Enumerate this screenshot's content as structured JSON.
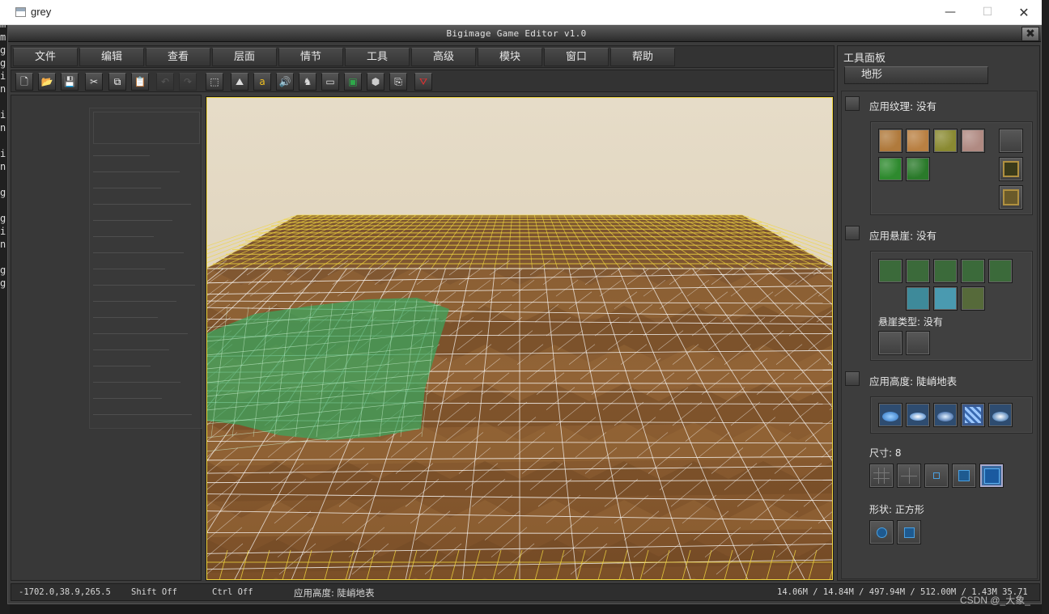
{
  "os_window": {
    "title": "grey",
    "minimize_glyph": "—",
    "maximize_glyph": "☐",
    "close_glyph": "✕"
  },
  "background_console": {
    "left_chars": [
      "i",
      "m",
      "m",
      "g",
      "g",
      "i",
      "n",
      "",
      "i",
      "n",
      "",
      "i",
      "n",
      "",
      "g",
      "",
      "g",
      "i",
      "n",
      "",
      "g",
      "g"
    ]
  },
  "app": {
    "caption": "Bigimage Game Editor v1.0",
    "caption_close_glyph": "✖"
  },
  "menu": {
    "items": [
      "文件",
      "编辑",
      "查看",
      "层面",
      "情节",
      "工具",
      "高级",
      "模块",
      "窗口",
      "帮助"
    ]
  },
  "toolbar": {
    "buttons": [
      {
        "name": "new-file-icon",
        "glyph": "🗋",
        "color": "#ffffff",
        "enabled": true
      },
      {
        "name": "open-folder-icon",
        "glyph": "📂",
        "color": "#e0b040",
        "enabled": true
      },
      {
        "name": "save-icon",
        "glyph": "💾",
        "color": "#c0c0c0",
        "enabled": true
      },
      {
        "name": "cut-icon",
        "glyph": "✂",
        "color": "#e0e0e0",
        "enabled": true
      },
      {
        "name": "copy-icon",
        "glyph": "⧉",
        "color": "#ffffff",
        "enabled": true
      },
      {
        "name": "paste-icon",
        "glyph": "📋",
        "color": "#ffffff",
        "enabled": true
      },
      {
        "name": "undo-icon",
        "glyph": "↶",
        "color": "#999999",
        "enabled": false
      },
      {
        "name": "redo-icon",
        "glyph": "↷",
        "color": "#999999",
        "enabled": false
      },
      {
        "name": "select-region-icon",
        "glyph": "⬚",
        "color": "#dddddd",
        "enabled": true
      },
      {
        "name": "terrain-icon",
        "glyph": "⛰",
        "color": "#dddddd",
        "enabled": true
      },
      {
        "name": "text-icon",
        "glyph": "a",
        "color": "#f0c020",
        "enabled": true
      },
      {
        "name": "sound-icon",
        "glyph": "🔊",
        "color": "#f0d050",
        "enabled": true
      },
      {
        "name": "unit-icon",
        "glyph": "♞",
        "color": "#dddddd",
        "enabled": true
      },
      {
        "name": "building-icon",
        "glyph": "▭",
        "color": "#dddddd",
        "enabled": true
      },
      {
        "name": "minimap-icon",
        "glyph": "▣",
        "color": "#2ea84a",
        "enabled": true
      },
      {
        "name": "object-icon",
        "glyph": "⬢",
        "color": "#cccccc",
        "enabled": true
      },
      {
        "name": "import-icon",
        "glyph": "⎘",
        "color": "#ffffff",
        "enabled": true
      },
      {
        "name": "export-icon",
        "glyph": "⛛",
        "color": "#e03030",
        "enabled": true
      }
    ]
  },
  "tool_panel": {
    "title": "工具面板",
    "tab": "地形",
    "texture": {
      "label": "应用纹理: 没有",
      "tiles": [
        {
          "name": "dirt-texture-tile",
          "color": "#b07a3c"
        },
        {
          "name": "sand-texture-tile",
          "color": "#b98042"
        },
        {
          "name": "grass-dirt-texture-tile",
          "color": "#8a8a32"
        },
        {
          "name": "rock-texture-tile",
          "color": "#b08a82"
        },
        {
          "name": "grass-texture-tile",
          "color": "#2e8a2e"
        },
        {
          "name": "dark-grass-texture-tile",
          "color": "#2a7a2a"
        }
      ]
    },
    "cliff": {
      "label": "应用悬崖: 没有",
      "type_label": "悬崖类型: 没有"
    },
    "height": {
      "label": "应用高度: 陡峭地表"
    },
    "size": {
      "label": "尺寸: 8"
    },
    "shape": {
      "label": "形状: 正方形"
    }
  },
  "status": {
    "coords": "-1702.0,38.9,265.5",
    "shift": "Shift Off",
    "ctrl": "Ctrl Off",
    "mode": "应用高度: 陡峭地表",
    "memory": "14.06M / 14.84M / 497.94M / 512.00M / 1.43M   35.71"
  },
  "watermark": "CSDN @_大象_",
  "colors": {
    "sky": "#e9dfcc",
    "terrain": "#8a5a2e",
    "grid_far": "#f0d640",
    "water": "#3aa860"
  }
}
